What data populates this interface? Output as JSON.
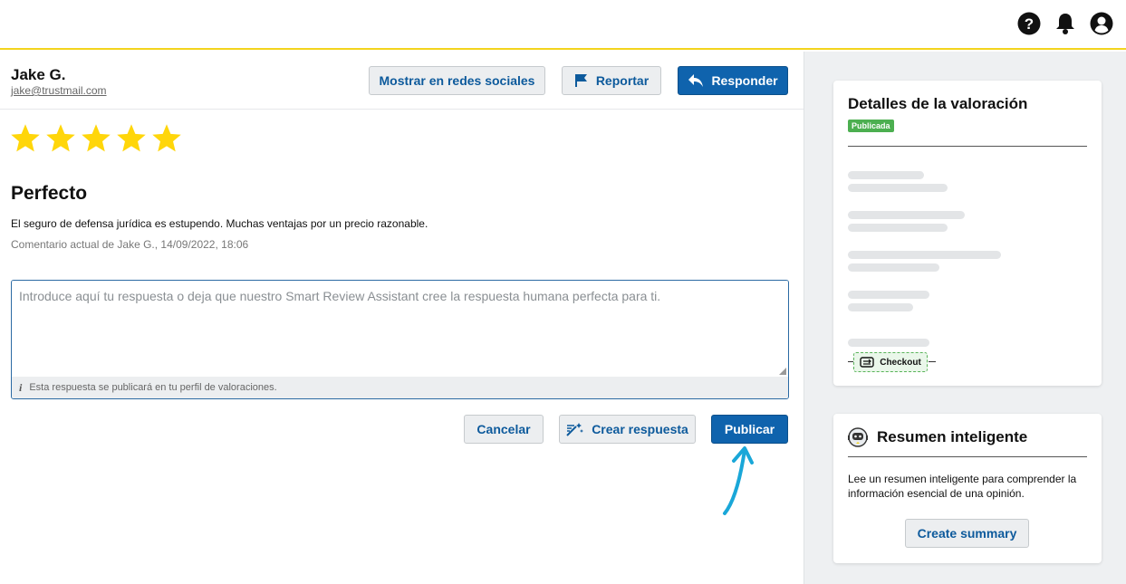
{
  "header": {
    "icons": [
      "help-icon",
      "bell-icon",
      "account-icon"
    ]
  },
  "review": {
    "reviewer_name": "Jake G.",
    "reviewer_email": "jake@trustmail.com",
    "rating": 5,
    "title": "Perfecto",
    "body": "El seguro de defensa jurídica es estupendo. Muchas ventajas por un precio razonable.",
    "meta": "Comentario actual de Jake G., 14/09/2022, 18:06"
  },
  "actions": {
    "social_label": "Mostrar en redes sociales",
    "report_label": "Reportar",
    "reply_label": "Responder"
  },
  "reply": {
    "placeholder": "Introduce aquí tu respuesta o deja que nuestro Smart Review Assistant cree la respuesta humana perfecta para ti.",
    "info": "Esta respuesta se publicará en tu perfil de valoraciones.",
    "cancel_label": "Cancelar",
    "create_label": "Crear respuesta",
    "publish_label": "Publicar"
  },
  "details": {
    "title": "Detalles de la valoración",
    "status": "Publicada",
    "checkout_label": "Checkout"
  },
  "summary": {
    "title": "Resumen inteligente",
    "text": "Lee un resumen inteligente para comprender la información esencial de una opinión.",
    "button_label": "Create summary"
  },
  "colors": {
    "accent_yellow": "#f3d41e",
    "star": "#ffd60a",
    "primary_blue": "#0f63ad",
    "link_blue": "#0d5a9c",
    "success_green": "#4caf50",
    "hint_cyan": "#1aa7d8"
  }
}
